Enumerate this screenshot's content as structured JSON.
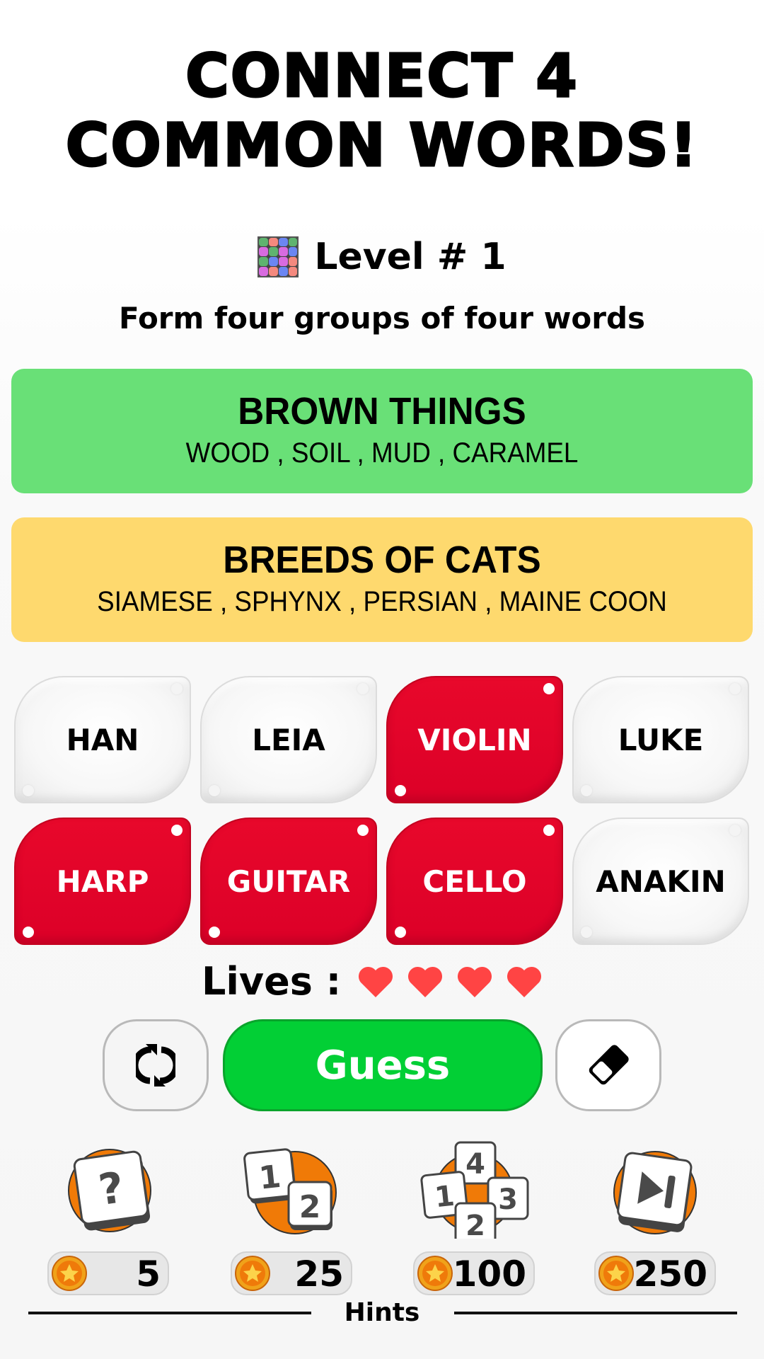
{
  "header": {
    "title_line1": "CONNECT 4",
    "title_line2": "COMMON WORDS!",
    "level_label": "Level # 1",
    "instructions": "Form four groups of four words"
  },
  "level_icon": {
    "name": "color-grid-icon",
    "cells": [
      "#5fb36f",
      "#f4897e",
      "#6b86f2",
      "#5fb36f",
      "#d86be0",
      "#5fb36f",
      "#d86be0",
      "#6b86f2",
      "#5fb36f",
      "#6b86f2",
      "#d86be0",
      "#f4897e",
      "#d86be0",
      "#f4897e",
      "#6b86f2",
      "#f4897e"
    ]
  },
  "solved_groups": [
    {
      "category": "BROWN THINGS",
      "words": "WOOD , SOIL , MUD , CARAMEL",
      "color": "#69e077"
    },
    {
      "category": "BREEDS OF CATS",
      "words": "SIAMESE , SPHYNX , PERSIAN , MAINE COON",
      "color": "#fed96e"
    }
  ],
  "tiles": [
    {
      "word": "HAN",
      "selected": false
    },
    {
      "word": "LEIA",
      "selected": false
    },
    {
      "word": "VIOLIN",
      "selected": true
    },
    {
      "word": "LUKE",
      "selected": false
    },
    {
      "word": "HARP",
      "selected": true
    },
    {
      "word": "GUITAR",
      "selected": true
    },
    {
      "word": "CELLO",
      "selected": true
    },
    {
      "word": "ANAKIN",
      "selected": false
    }
  ],
  "lives": {
    "label": "Lives :",
    "remaining": 4,
    "max": 4,
    "heart_color": "#ff4444"
  },
  "actions": {
    "shuffle_icon": "shuffle-icon",
    "guess_label": "Guess",
    "erase_icon": "eraser-icon",
    "guess_color": "#02cf35"
  },
  "hints": {
    "label": "Hints",
    "items": [
      {
        "icon": "reveal-letter-icon",
        "glyph": "?",
        "cost": "5"
      },
      {
        "icon": "reveal-two-icon",
        "glyph": "12",
        "cost": "25"
      },
      {
        "icon": "reveal-four-icon",
        "glyph": "1234",
        "cost": "100"
      },
      {
        "icon": "skip-level-icon",
        "glyph": "skip",
        "cost": "250"
      }
    ],
    "accent": "#f07a07"
  }
}
